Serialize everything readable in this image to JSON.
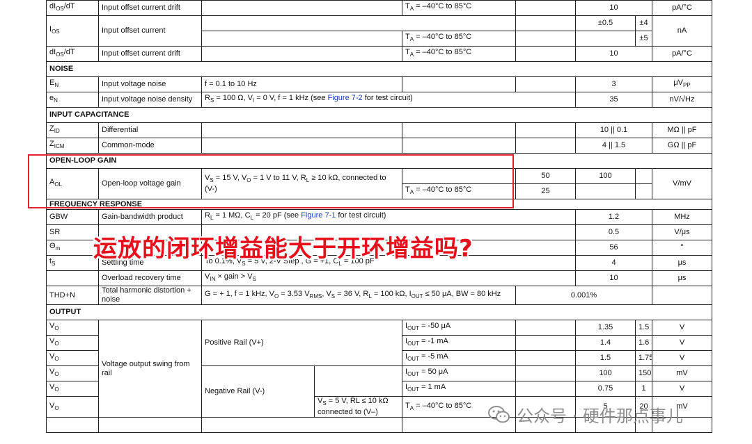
{
  "rows": {
    "r1": {
      "sym": "dI",
      "sub": "OS",
      "sym2": "/dT",
      "param": "Input offset current drift",
      "cond2": "T",
      "cond2_sub": "A",
      "cond2_rest": " = –40°C to 85°C",
      "typ": "10",
      "unit": "pA/°C"
    },
    "r2": {
      "sym": "I",
      "sub": "OS",
      "param": "Input offset current",
      "typ": "±0.5",
      "max": "±4",
      "unit": "nA"
    },
    "r3": {
      "cond2": "T",
      "cond2_sub": "A",
      "cond2_rest": " = –40°C to 85°C",
      "max": "±5"
    },
    "r4": {
      "sym": "dI",
      "sub": "OS",
      "sym2": "/dT",
      "param": "Input offset current drift",
      "cond2": "T",
      "cond2_sub": "A",
      "cond2_rest": " = –40°C to 85°C",
      "typ": "10",
      "unit": "pA/°C"
    },
    "noise": "NOISE",
    "r5": {
      "sym": "E",
      "sub": "N",
      "param": "Input voltage noise",
      "cond": "f = 0.1 to 10 Hz",
      "typ": "3",
      "unit": "μV",
      "unit_sub": "PP"
    },
    "r6": {
      "sym": "e",
      "sub": "N",
      "param": "Input voltage noise density",
      "cond_a": "R",
      "cond_a_sub": "S",
      "cond_b": " = 100 Ω, V",
      "cond_b_sub": "I",
      "cond_c": " = 0 V, f = 1 kHz (see ",
      "link": "Figure 7-2",
      "cond_d": " for test circuit)",
      "typ": "35",
      "unit": "nV/√Hz"
    },
    "incap": "INPUT CAPACITANCE",
    "r7": {
      "sym": "Z",
      "sub": "ID",
      "param": "Differential",
      "typ": "10 || 0.1",
      "unit": "MΩ || pF"
    },
    "r8": {
      "sym": "Z",
      "sub": "ICM",
      "param": "Common-mode",
      "typ": "4 || 1.5",
      "unit": "GΩ || pF"
    },
    "olg": "OPEN-LOOP GAIN",
    "r9": {
      "sym": "A",
      "sub": "OL",
      "param": "Open-loop voltage gain",
      "cond": "V",
      "cond_sub1": "S",
      "cond_mid1": " = 15 V, V",
      "cond_sub2": "O",
      "cond_mid2": " = 1 V to 11 V, R",
      "cond_sub3": "L",
      "cond_mid3": " ≥ 10 kΩ, connected to (V-)",
      "min": "50",
      "typ": "100",
      "unit": "V/mV"
    },
    "r10": {
      "cond2": "T",
      "cond2_sub": "A",
      "cond2_rest": " = –40°C to 85°C",
      "min": "25"
    },
    "freq": "FREQUENCY RESPONSE",
    "r11": {
      "sym": "GBW",
      "param": "Gain-bandwidth product",
      "cond_a": "R",
      "cond_a_sub": "L",
      "cond_b": " = 1 MΩ, C",
      "cond_b_sub": "L",
      "cond_c": " = 20 pF (see ",
      "link": "Figure 7-1",
      "cond_d": " for test circuit)",
      "typ": "1.2",
      "unit": "MHz"
    },
    "r12": {
      "sym": "SR",
      "typ": "0.5",
      "unit": "V/μs"
    },
    "r13": {
      "sym": "Θ",
      "sub": "m",
      "typ": "56",
      "unit": "°"
    },
    "r14": {
      "sym": "t",
      "sub": "S",
      "param": "Settling time",
      "cond": "To 0.1%, V",
      "cond_sub1": "S",
      "cond_mid1": " = 5 V, 2-V Step , G = +1, C",
      "cond_sub2": "L",
      "cond_mid2": " = 100 pF",
      "typ": "4",
      "unit": "μs"
    },
    "r15": {
      "param": "Overload recovery time",
      "cond": "V",
      "cond_sub1": "IN",
      "cond_mid1": " × gain > V",
      "cond_sub2": "S",
      "typ": "10",
      "unit": "μs"
    },
    "r16": {
      "sym": "THD+N",
      "param": "Total harmonic distortion + noise",
      "cond": "G = + 1, f = 1 kHz, V",
      "cond_sub1": "O",
      "cond_mid1": " = 3.53 V",
      "cond_sub2": "RMS",
      "cond_mid2": ", V",
      "cond_sub3": "S",
      "cond_mid3": " = 36 V, R",
      "cond_sub4": "L",
      "cond_mid4": " = 100 kΩ, I",
      "cond_sub5": "OUT",
      "cond_mid5": " ≤ 50 μA, BW = 80 kHz",
      "typ": "0.001%"
    },
    "output": "OUTPUT",
    "out_param": "Voltage output swing from rail",
    "pos_rail": "Positive Rail (V+)",
    "neg_rail": "Negative Rail (V-)",
    "neg_cond": "V",
    "neg_cond_sub": "S",
    "neg_cond_rest": " = 5 V, RL ≤ 10 kΩ connected to (V–)",
    "o1": {
      "sym": "V",
      "sub": "O",
      "iout": "-50 μA",
      "typ": "1.35",
      "max": "1.5",
      "unit": "V"
    },
    "o2": {
      "sym": "V",
      "sub": "O",
      "iout": "-1 mA",
      "typ": "1.4",
      "max": "1.6",
      "unit": "V"
    },
    "o3": {
      "sym": "V",
      "sub": "O",
      "iout": "-5 mA",
      "typ": "1.5",
      "max": "1.75",
      "unit": "V"
    },
    "o4": {
      "sym": "V",
      "sub": "O",
      "iout": "50 μA",
      "typ": "100",
      "max": "150",
      "unit": "mV"
    },
    "o5": {
      "sym": "V",
      "sub": "O",
      "iout": "1 mA",
      "typ": "0.75",
      "max": "1",
      "unit": "V"
    },
    "o6": {
      "sym": "V",
      "sub": "O",
      "cond2": "T",
      "cond2_sub": "A",
      "cond2_rest": " = –40°C to 85°C",
      "typ": "5",
      "max": "20",
      "unit": "mV"
    },
    "iout_prefix": "I",
    "iout_sub": "OUT",
    "iout_eq": " = "
  },
  "overlay": {
    "question": "运放的闭环增益能大于开环增益吗?"
  },
  "watermark": {
    "text": "公众号 · 硬件那点事儿"
  },
  "colors": {
    "highlight": "#e3242b",
    "overlay_text": "#e60f1c",
    "link": "#1a3fb3"
  }
}
